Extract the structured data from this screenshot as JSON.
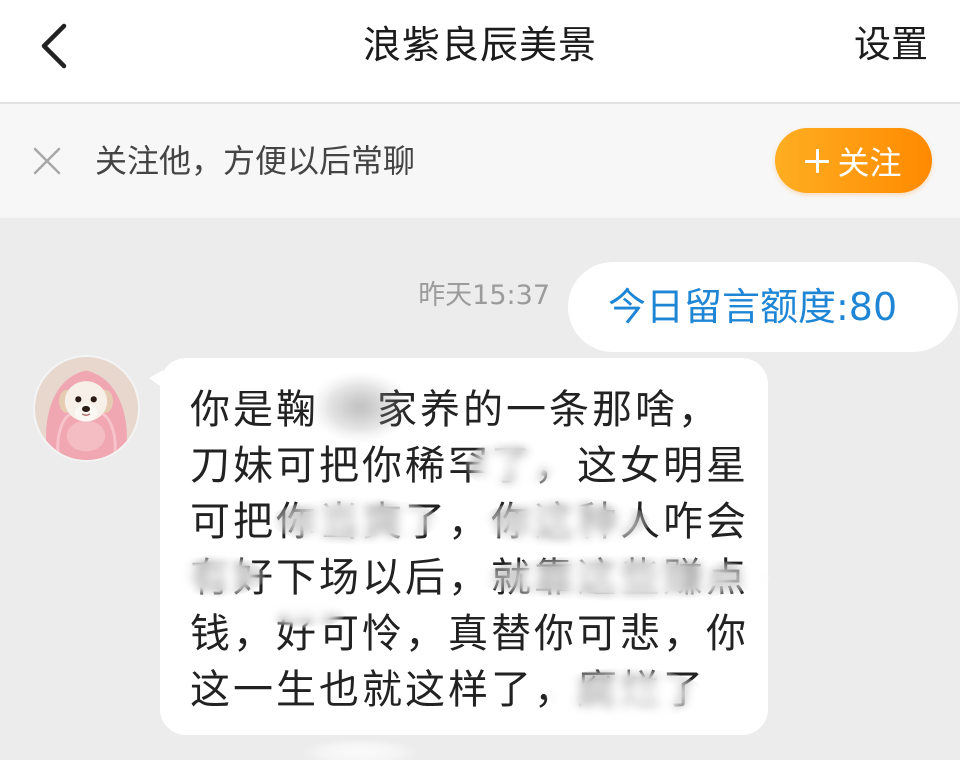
{
  "header": {
    "back_icon": "chevron-left-icon",
    "title": "浪紫良辰美景",
    "settings_label": "设置"
  },
  "follow_bar": {
    "close_icon": "close-icon",
    "prompt": "关注他，方便以后常聊",
    "follow_icon": "plus-icon",
    "follow_label": "关注"
  },
  "chat": {
    "timestamp": "昨天15:37",
    "outgoing_message": "今日留言额度:80",
    "incoming_message": {
      "avatar": "dog-avatar",
      "lines": [
        [
          "你是鞠",
          "家养的一条那啥，"
        ],
        [
          "刀妹可把你稀罕了，这女明星"
        ],
        [
          "可把你当爽了，你这种人咋会"
        ],
        [
          "有好下场以后，就靠这些赚点"
        ],
        [
          "钱，好可怜，真替你可悲，你"
        ],
        [
          "这一生也就这样了，腐烂了"
        ]
      ]
    }
  },
  "colors": {
    "header_bg": "#ffffff",
    "follow_bar_bg": "#f7f7f7",
    "chat_bg": "#ececec",
    "follow_button_start": "#ffae22",
    "follow_button_end": "#ff8a00",
    "outgoing_text": "#1f86d6",
    "timestamp_text": "#9b9b9b"
  }
}
